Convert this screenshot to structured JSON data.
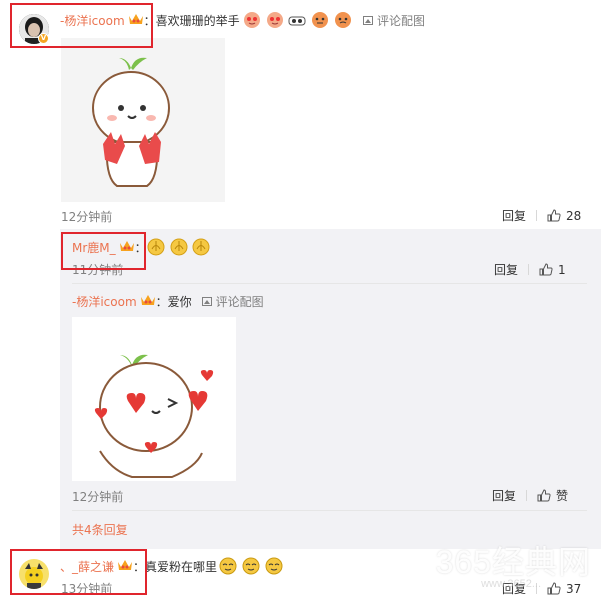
{
  "comment1": {
    "username": "-杨洋icoom",
    "colon": "：",
    "text": "喜欢珊珊的举手",
    "view_pic": "评论配图",
    "time": "12分钟前",
    "reply_label": "回复",
    "like_count": "28"
  },
  "reply1": {
    "username": "Mr鹿M_",
    "colon": "：",
    "time": "11分钟前",
    "reply_label": "回复",
    "like_count": "1"
  },
  "reply2": {
    "username": "-杨洋icoom",
    "colon": "：",
    "text": "爱你",
    "view_pic": "评论配图",
    "time": "12分钟前",
    "reply_label": "回复",
    "like_label": "赞"
  },
  "more_replies": "共4条回复",
  "comment2": {
    "username": "、_薛之谦",
    "colon": "：",
    "text": "真爱粉在哪里",
    "time": "13分钟前",
    "reply_label": "回复",
    "like_count": "37"
  },
  "watermark": {
    "text": "365经典网",
    "url": "www.3652..."
  },
  "colors": {
    "link": "#eb7350",
    "highlight_box": "#e0252d",
    "reply_bg": "#f2f2f5"
  },
  "icons": [
    "verified-badge-icon",
    "vip-crown-icon",
    "picture-icon",
    "thumbs-up-icon",
    "emoji-icon"
  ]
}
